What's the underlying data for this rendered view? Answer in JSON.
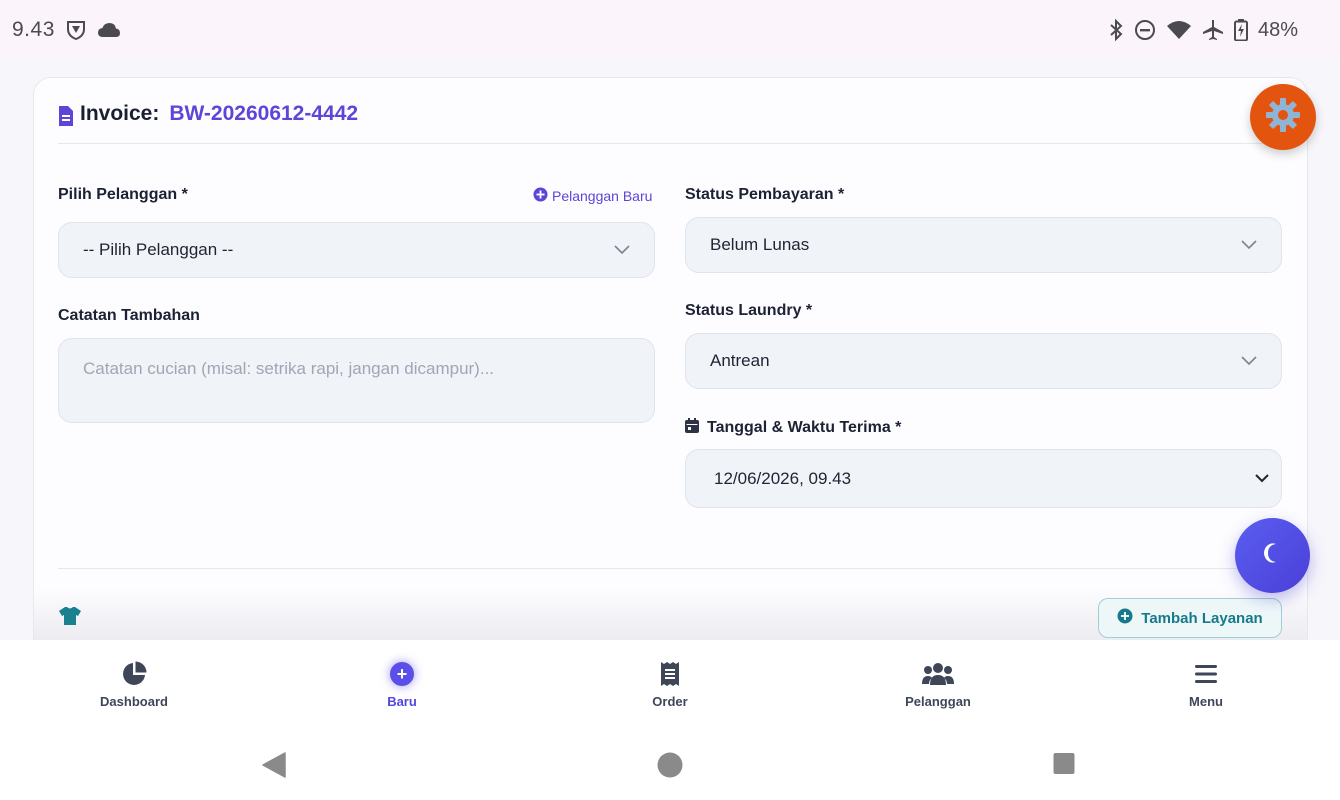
{
  "status_bar": {
    "time": "9.43",
    "battery_percent": "48%",
    "left_icons": [
      "vpn-shield-icon",
      "cloud-icon"
    ],
    "right_icons": [
      "bluetooth-icon",
      "do-not-disturb-icon",
      "wifi-icon",
      "airplane-icon",
      "battery-icon"
    ]
  },
  "header": {
    "invoice_label": "Invoice:",
    "invoice_number": "BW-20260612-4442"
  },
  "form": {
    "customer_label": "Pilih Pelanggan *",
    "new_customer_link": "Pelanggan Baru",
    "customer_value": "-- Pilih Pelanggan --",
    "notes_label": "Catatan Tambahan",
    "notes_placeholder": "Catatan cucian (misal: setrika rapi, jangan dicampur)...",
    "payment_status_label": "Status Pembayaran *",
    "payment_status_value": "Belum Lunas",
    "laundry_status_label": "Status Laundry *",
    "laundry_status_value": "Antrean",
    "received_label": "Tanggal & Waktu Terima *",
    "received_value": "12/06/2026, 09.43"
  },
  "services": {
    "add_service_button": "Tambah Layanan"
  },
  "bottom_nav": {
    "items": [
      {
        "label": "Dashboard",
        "icon": "pie-chart-icon"
      },
      {
        "label": "Baru",
        "icon": "plus-circle-icon",
        "active": true
      },
      {
        "label": "Order",
        "icon": "receipt-icon"
      },
      {
        "label": "Pelanggan",
        "icon": "users-icon"
      },
      {
        "label": "Menu",
        "icon": "hamburger-icon"
      }
    ]
  },
  "colors": {
    "accent": "#5b46d8",
    "gear_fab": "#e3550e",
    "moon_fab": "#4f46e5",
    "teal": "#177a8c"
  }
}
